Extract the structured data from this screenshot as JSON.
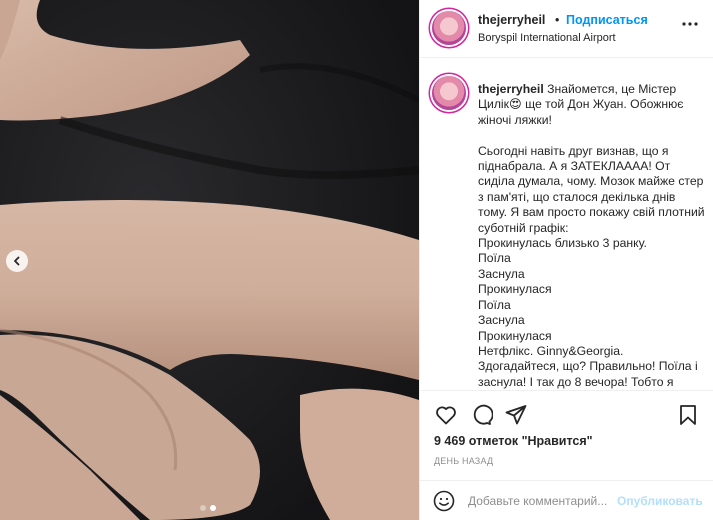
{
  "post": {
    "username": "thejerryheil",
    "separator": "•",
    "follow_label": "Подписаться",
    "location": "Boryspil International Airport"
  },
  "caption": {
    "username": "thejerryheil",
    "text": "Знайомется, це Містер Цилік😍 ще той Дон Жуан. Обожнює жіночі ляжки!\n\nСьогодні навіть друг визнав, що я піднабрала. А я ЗАТЕКЛАААА! От сиділа думала, чому. Мозок майже стер з пам'яті, що сталося декілька днів тому. Я вам просто покажу свій плотний суботній графік:\nПрокинулась близько 3 ранку.\nПоїла\nЗаснула\nПрокинулася\nПоїла\nЗаснула\nПрокинулася\nНетфлікс. Ginny&Georgia.\nЗдогадайтеся, що? Правильно! Поїла і заснула! І так до 8 вечора! Тобто я"
  },
  "likes": {
    "count": "9 469",
    "label": "отметок \"Нравится\""
  },
  "time_ago": "день назад",
  "comment": {
    "placeholder": "Добавьте комментарий...",
    "post_label": "Опубликовать"
  },
  "carousel": {
    "slide_count": 2,
    "active_index": 1
  },
  "icons": {
    "prev": "chevron-left-icon",
    "more": "more-horizontal-icon",
    "like": "heart-icon",
    "comment": "comment-icon",
    "share": "share-icon",
    "save": "bookmark-icon",
    "emoji": "smiley-icon"
  },
  "colors": {
    "accent": "#0095f6",
    "post_disabled": "#b2dffc",
    "secondary_text": "#8e8e8e",
    "border": "#efefef"
  }
}
